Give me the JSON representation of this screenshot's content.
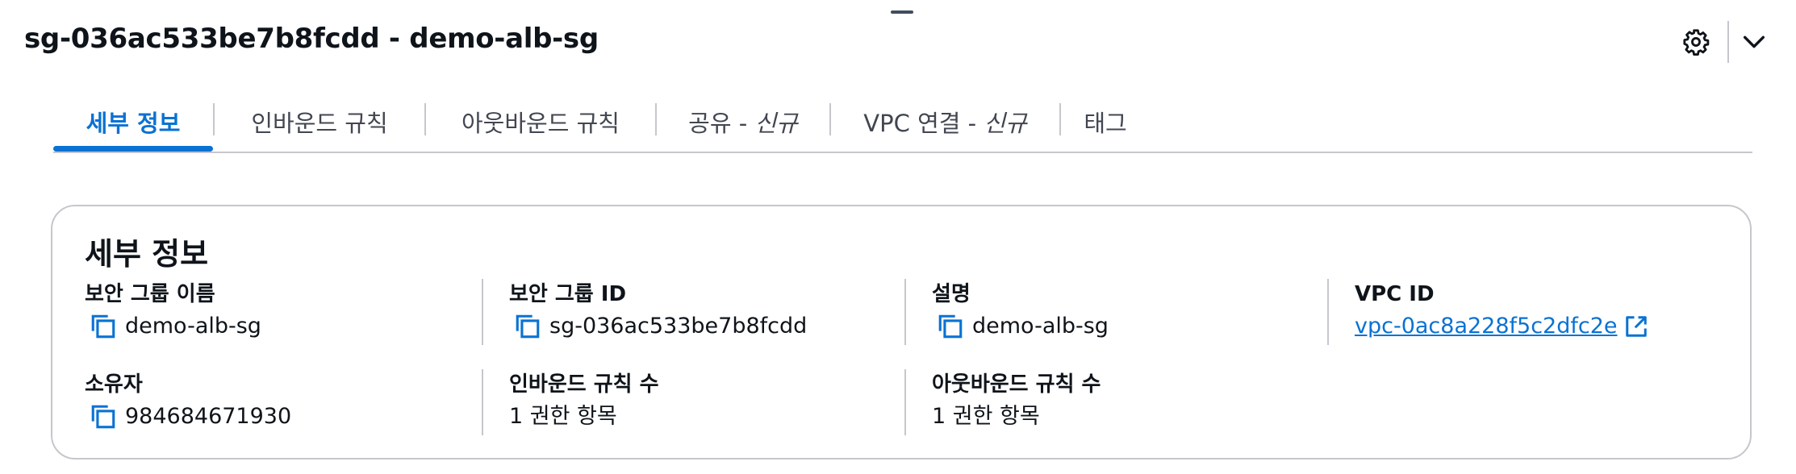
{
  "header": {
    "title": "sg-036ac533be7b8fcdd - demo-alb-sg",
    "icons": {
      "settings": "gear-icon",
      "collapse": "chevron-down-icon"
    }
  },
  "tabs": [
    {
      "label": "세부 정보",
      "active": true
    },
    {
      "label": "인바운드 규칙"
    },
    {
      "label": "아웃바운드 규칙"
    },
    {
      "label": "공유 - ",
      "new_label": "신규"
    },
    {
      "label": "VPC 연결 - ",
      "new_label": "신규"
    },
    {
      "label": "태그"
    }
  ],
  "details": {
    "title": "세부 정보",
    "sg_name_label": "보안 그룹 이름",
    "sg_name_value": "demo-alb-sg",
    "sg_id_label": "보안 그룹 ID",
    "sg_id_value": "sg-036ac533be7b8fcdd",
    "description_label": "설명",
    "description_value": "demo-alb-sg",
    "vpc_id_label": "VPC ID",
    "vpc_id_value": "vpc-0ac8a228f5c2dfc2e",
    "owner_label": "소유자",
    "owner_value": "984684671930",
    "inbound_count_label": "인바운드 규칙 수",
    "inbound_count_value": "1 권한 항목",
    "outbound_count_label": "아웃바운드 규칙 수",
    "outbound_count_value": "1 권한 항목"
  },
  "colors": {
    "accent": "#0972d3",
    "text": "#0f141a",
    "border": "#c6c6cd"
  }
}
